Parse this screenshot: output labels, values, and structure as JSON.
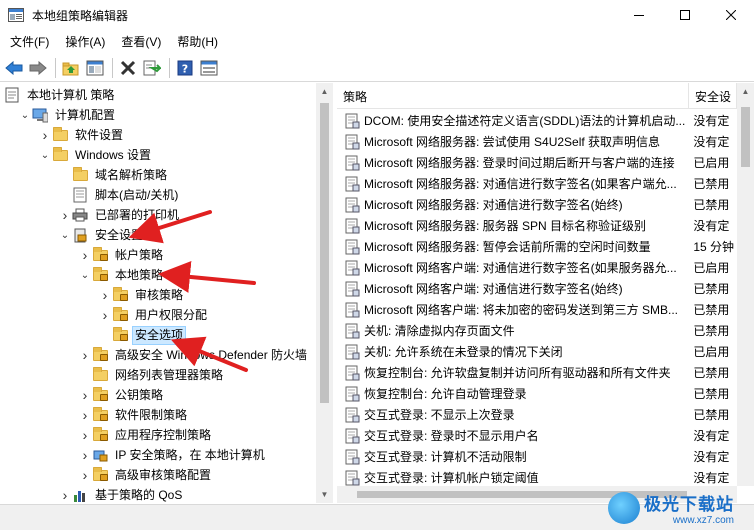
{
  "window": {
    "title": "本地组策略编辑器",
    "controls": [
      "minimize",
      "maximize",
      "close"
    ]
  },
  "menu": [
    "文件(F)",
    "操作(A)",
    "查看(V)",
    "帮助(H)"
  ],
  "toolbar": [
    "back-icon",
    "forward-icon",
    "up-folder-icon",
    "show-tree-icon",
    "delete-icon",
    "export-icon",
    "help-icon",
    "properties-icon"
  ],
  "tree": [
    {
      "label": "本地计算机 策略",
      "icon": "policy-icon",
      "expander": "",
      "depth": 0
    },
    {
      "label": "计算机配置",
      "icon": "computer-icon",
      "expander": "open",
      "depth": 1
    },
    {
      "label": "软件设置",
      "icon": "folder-icon",
      "expander": "closed",
      "depth": 2
    },
    {
      "label": "Windows 设置",
      "icon": "folder-icon",
      "expander": "open",
      "depth": 2
    },
    {
      "label": "域名解析策略",
      "icon": "folder-icon",
      "expander": "",
      "depth": 3
    },
    {
      "label": "脚本(启动/关机)",
      "icon": "script-icon",
      "expander": "",
      "depth": 3
    },
    {
      "label": "已部署的打印机",
      "icon": "printer-icon",
      "expander": "closed",
      "depth": 3
    },
    {
      "label": "安全设置",
      "icon": "security-icon",
      "expander": "open",
      "depth": 3
    },
    {
      "label": "帐户策略",
      "icon": "folder-lock-icon",
      "expander": "closed",
      "depth": 4
    },
    {
      "label": "本地策略",
      "icon": "folder-lock-icon",
      "expander": "open",
      "depth": 4
    },
    {
      "label": "审核策略",
      "icon": "folder-lock-icon",
      "expander": "closed",
      "depth": 5
    },
    {
      "label": "用户权限分配",
      "icon": "folder-lock-icon",
      "expander": "closed",
      "depth": 5
    },
    {
      "label": "安全选项",
      "icon": "folder-lock-icon",
      "expander": "",
      "depth": 5,
      "selected": true
    },
    {
      "label": "高级安全 Windows Defender 防火墙",
      "icon": "folder-lock-icon",
      "expander": "closed",
      "depth": 4
    },
    {
      "label": "网络列表管理器策略",
      "icon": "folder-icon",
      "expander": "",
      "depth": 4
    },
    {
      "label": "公钥策略",
      "icon": "folder-lock-icon",
      "expander": "closed",
      "depth": 4
    },
    {
      "label": "软件限制策略",
      "icon": "folder-lock-icon",
      "expander": "closed",
      "depth": 4
    },
    {
      "label": "应用程序控制策略",
      "icon": "folder-lock-icon",
      "expander": "closed",
      "depth": 4
    },
    {
      "label": "IP 安全策略，在 本地计算机",
      "icon": "ip-security-icon",
      "expander": "closed",
      "depth": 4
    },
    {
      "label": "高级审核策略配置",
      "icon": "folder-lock-icon",
      "expander": "closed",
      "depth": 4
    },
    {
      "label": "基于策略的 QoS",
      "icon": "chart-icon",
      "expander": "closed",
      "depth": 3
    }
  ],
  "list": {
    "columns": [
      "策略",
      "安全设"
    ],
    "rows": [
      {
        "name": "DCOM: 使用安全描述符定义语言(SDDL)语法的计算机启动...",
        "setting": "没有定"
      },
      {
        "name": "Microsoft 网络服务器: 尝试使用 S4U2Self 获取声明信息",
        "setting": "没有定"
      },
      {
        "name": "Microsoft 网络服务器: 登录时间过期后断开与客户端的连接",
        "setting": "已启用"
      },
      {
        "name": "Microsoft 网络服务器: 对通信进行数字签名(如果客户端允...",
        "setting": "已禁用"
      },
      {
        "name": "Microsoft 网络服务器: 对通信进行数字签名(始终)",
        "setting": "已禁用"
      },
      {
        "name": "Microsoft 网络服务器: 服务器 SPN 目标名称验证级别",
        "setting": "没有定"
      },
      {
        "name": "Microsoft 网络服务器: 暂停会话前所需的空闲时间数量",
        "setting": "15 分钟"
      },
      {
        "name": "Microsoft 网络客户端: 对通信进行数字签名(如果服务器允...",
        "setting": "已启用"
      },
      {
        "name": "Microsoft 网络客户端: 对通信进行数字签名(始终)",
        "setting": "已禁用"
      },
      {
        "name": "Microsoft 网络客户端: 将未加密的密码发送到第三方 SMB...",
        "setting": "已禁用"
      },
      {
        "name": "关机: 清除虚拟内存页面文件",
        "setting": "已禁用"
      },
      {
        "name": "关机: 允许系统在未登录的情况下关闭",
        "setting": "已启用"
      },
      {
        "name": "恢复控制台: 允许软盘复制并访问所有驱动器和所有文件夹",
        "setting": "已禁用"
      },
      {
        "name": "恢复控制台: 允许自动管理登录",
        "setting": "已禁用"
      },
      {
        "name": "交互式登录: 不显示上次登录",
        "setting": "已禁用"
      },
      {
        "name": "交互式登录: 登录时不显示用户名",
        "setting": "没有定"
      },
      {
        "name": "交互式登录: 计算机不活动限制",
        "setting": "没有定"
      },
      {
        "name": "交互式登录: 计算机帐户锁定阈值",
        "setting": "没有定"
      }
    ]
  },
  "watermark": {
    "title": "极光下载站",
    "url": "www.xz7.com"
  },
  "colors": {
    "selection": "#cce8ff",
    "annotation_arrow": "#e02020",
    "watermark": "#1a6fc8"
  }
}
